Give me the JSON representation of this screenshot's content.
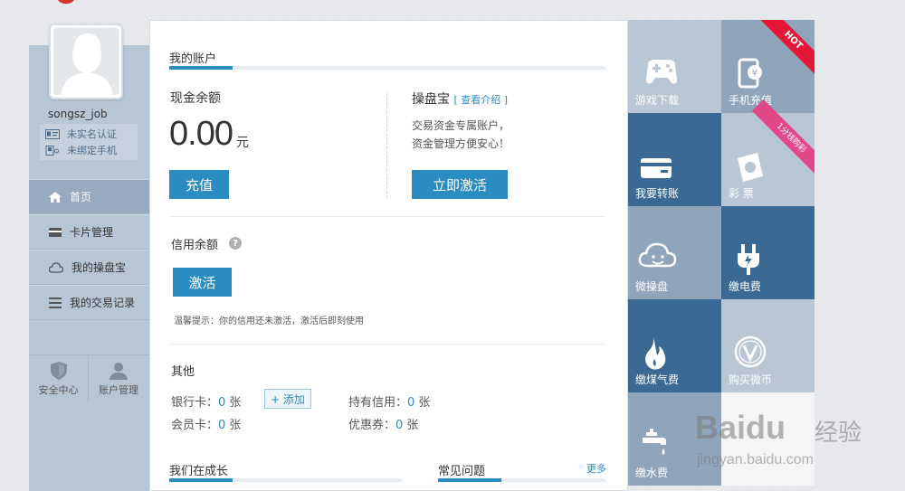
{
  "sidebar": {
    "username": "songsz_job",
    "verify": [
      {
        "icon": "id-card-icon",
        "label": "未实名认证"
      },
      {
        "icon": "phone-bind-icon",
        "label": "未绑定手机"
      }
    ],
    "nav": [
      {
        "icon": "home-icon",
        "label": "首页",
        "active": true
      },
      {
        "icon": "card-icon",
        "label": "卡片管理"
      },
      {
        "icon": "cloud-icon",
        "label": "我的操盘宝"
      },
      {
        "icon": "list-icon",
        "label": "我的交易记录"
      }
    ],
    "quick_links": [
      {
        "icon": "shield-icon",
        "label": "安全中心"
      },
      {
        "icon": "user-icon",
        "label": "账户管理"
      }
    ]
  },
  "account": {
    "title": "我的账户",
    "cash_label": "现金余额",
    "cash_amount": "0.00",
    "cash_unit": "元",
    "recharge_button": "充值",
    "caopanbao_title": "操盘宝",
    "caopanbao_link": "[ 查看介绍 ]",
    "caopanbao_desc_1": "交易资金专属账户，",
    "caopanbao_desc_2": "资金管理方便安心！",
    "activate_now_button": "立即激活",
    "credit_label": "信用余额",
    "help_glyph": "?",
    "activate_button": "激活",
    "credit_tip": "温馨提示：你的信用还未激活，激活后即刻使用"
  },
  "other": {
    "title": "其他",
    "bank_card_label": "银行卡：",
    "bank_card_count": "0",
    "bank_card_unit": " 张",
    "add_button": "+ 添加",
    "credit_held_label": "持有信用：",
    "credit_held_count": "0",
    "credit_held_unit": " 张",
    "member_card_label": "会员卡：",
    "member_card_count": "0",
    "member_card_unit": " 张",
    "coupon_label": "优惠券：",
    "coupon_count": "0",
    "coupon_unit": " 张"
  },
  "bottom": {
    "growing_title": "我们在成长",
    "faq_title": "常见问题",
    "more_link": "更多"
  },
  "tiles": [
    {
      "icon": "gamepad-icon",
      "label": "游戏下载",
      "badge": "HOT"
    },
    {
      "icon": "mobile-recharge-icon",
      "label": "手机充值"
    },
    {
      "icon": "transfer-card-icon",
      "label": "我要转账"
    },
    {
      "icon": "lottery-icon",
      "label": "彩 票",
      "badge": "1分钱购彩"
    },
    {
      "icon": "cloud-face-icon",
      "label": "微操盘"
    },
    {
      "icon": "plug-icon",
      "label": "缴电费"
    },
    {
      "icon": "flame-icon",
      "label": "缴煤气费"
    },
    {
      "icon": "v-coin-icon",
      "label": "购买微币"
    },
    {
      "icon": "faucet-icon",
      "label": "缴水费"
    }
  ],
  "watermark": {
    "brand": "Bai",
    "brand_paw": "du",
    "brand_cn": "经验",
    "url": "jingyan.baidu.com"
  },
  "colors": {
    "accent": "#2a8cc0",
    "tile_light": "#8ea5bc",
    "tile_dark": "#3a6a94",
    "tile_pale": "#b9c7d5",
    "hot_ribbon": "#e4163a",
    "promo_ribbon": "#e2478a"
  }
}
